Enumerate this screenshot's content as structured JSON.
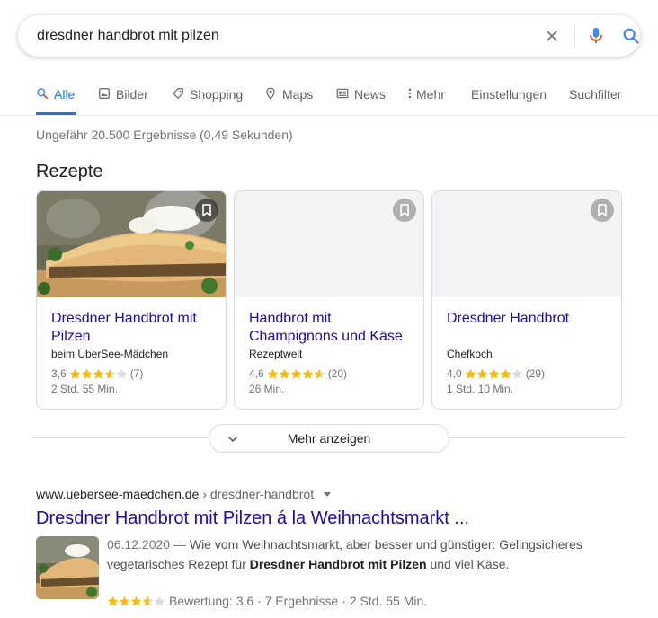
{
  "search": {
    "query": "dresdner handbrot mit pilzen",
    "clear_icon": "close-icon",
    "mic_icon": "mic-icon",
    "search_icon": "search-icon"
  },
  "tabs": [
    {
      "label": "Alle",
      "icon": "search-icon",
      "active": true
    },
    {
      "label": "Bilder",
      "icon": "image-icon"
    },
    {
      "label": "Shopping",
      "icon": "tag-icon"
    },
    {
      "label": "Maps",
      "icon": "location-pin-icon"
    },
    {
      "label": "News",
      "icon": "news-icon"
    },
    {
      "label": "Mehr",
      "icon": "more-vert-icon"
    },
    {
      "label": "Einstellungen"
    },
    {
      "label": "Suchfilter"
    }
  ],
  "result_stats": "Ungefähr 20.500 Ergebnisse (0,49 Sekunden)",
  "recipes": {
    "heading": "Rezepte",
    "cards": [
      {
        "title": "Dresdner Handbrot mit Pilzen",
        "source": "beim ÜberSee-Mädchen",
        "rating": "3,6",
        "rating_value": 3.6,
        "reviews": "(7)",
        "time": "2 Std. 55 Min.",
        "has_image": true
      },
      {
        "title": "Handbrot mit Champignons und Käse",
        "source": "Rezeptwelt",
        "rating": "4,6",
        "rating_value": 4.6,
        "reviews": "(20)",
        "time": "26 Min.",
        "has_image": false
      },
      {
        "title": "Dresdner Handbrot",
        "source": "Chefkoch",
        "rating": "4,0",
        "rating_value": 4.0,
        "reviews": "(29)",
        "time": "1 Std. 10 Min.",
        "has_image": false
      }
    ],
    "more_label": "Mehr anzeigen"
  },
  "result": {
    "url": "www.uebersee-maedchen.de",
    "path": "› dresdner-handbrot",
    "title": "Dresdner Handbrot mit Pilzen á la Weihnachtsmarkt ...",
    "date": "06.12.2020 —",
    "snippet_a": " Wie vom Weihnachtsmarkt, aber besser und günstiger: Gelingsicheres vegetarisches Rezept für ",
    "snippet_bold": "Dresdner Handbrot mit Pilzen",
    "snippet_b": " und viel Käse.",
    "rating_value": 3.6,
    "rating_text": "Bewertung: 3,6 · 7 Ergebnisse · 2 Std. 55 Min."
  },
  "colors": {
    "accent": "#1a73e8",
    "link": "#1a0dab",
    "star": "#fbbc04",
    "star_empty": "#dadce0"
  }
}
